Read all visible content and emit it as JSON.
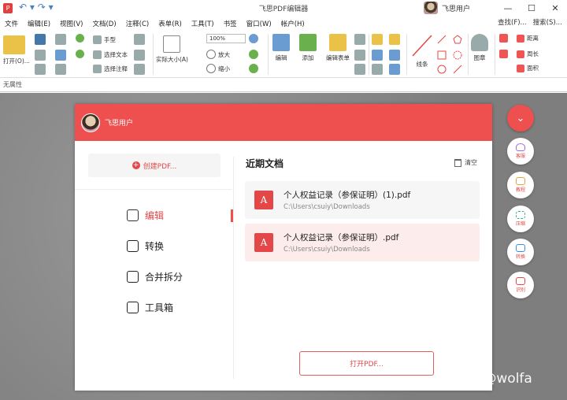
{
  "window": {
    "title": "飞思PDF编辑器",
    "user_name": "飞思用户",
    "minimize": "—",
    "maximize": "☐",
    "close": "✕"
  },
  "menu": {
    "items": [
      "文件",
      "编辑(E)",
      "视图(V)",
      "文档(D)",
      "注释(C)",
      "表单(R)",
      "工具(T)",
      "书签",
      "窗口(W)",
      "帐户(H)"
    ],
    "find": "查找(F)...",
    "search": "搜索(S)..."
  },
  "ribbon": {
    "open": "打开(O)...",
    "hand": "手型",
    "select_text": "选择文本",
    "select_annot": "选择注释",
    "actual_size": "实际大小(A)",
    "zoom_value": "100%",
    "zoom_in": "放大",
    "zoom_out": "缩小",
    "edit": "编辑",
    "add": "添加",
    "edit_form": "编辑表单",
    "line": "线条",
    "stamp": "图章",
    "distance": "距离",
    "perimeter": "周长",
    "area": "面积"
  },
  "props": {
    "label": "无属性"
  },
  "panel": {
    "user_name": "飞思用户",
    "create_pdf": "创建PDF...",
    "nav": [
      {
        "label": "编辑",
        "active": true
      },
      {
        "label": "转换",
        "active": false
      },
      {
        "label": "合并拆分",
        "active": false
      },
      {
        "label": "工具箱",
        "active": false
      }
    ],
    "recent_title": "近期文档",
    "clear": "清空",
    "files": [
      {
        "name": "个人权益记录（参保证明）(1).pdf",
        "path": "C:\\Users\\csuiy\\Downloads"
      },
      {
        "name": "个人权益记录（参保证明）.pdf",
        "path": "C:\\Users\\csuiy\\Downloads"
      }
    ],
    "open_pdf": "打开PDF..."
  },
  "side_buttons": [
    {
      "label": "客服",
      "icon": "headset-icon"
    },
    {
      "label": "教程",
      "icon": "book-icon"
    },
    {
      "label": "压缩",
      "icon": "compress-icon"
    },
    {
      "label": "转换",
      "icon": "convert-icon"
    },
    {
      "label": "识别",
      "icon": "ocr-icon"
    }
  ],
  "watermark": "知乎 @wolfa",
  "colors": {
    "accent": "#ee4f4f",
    "workspace": "#8a8a8a"
  }
}
